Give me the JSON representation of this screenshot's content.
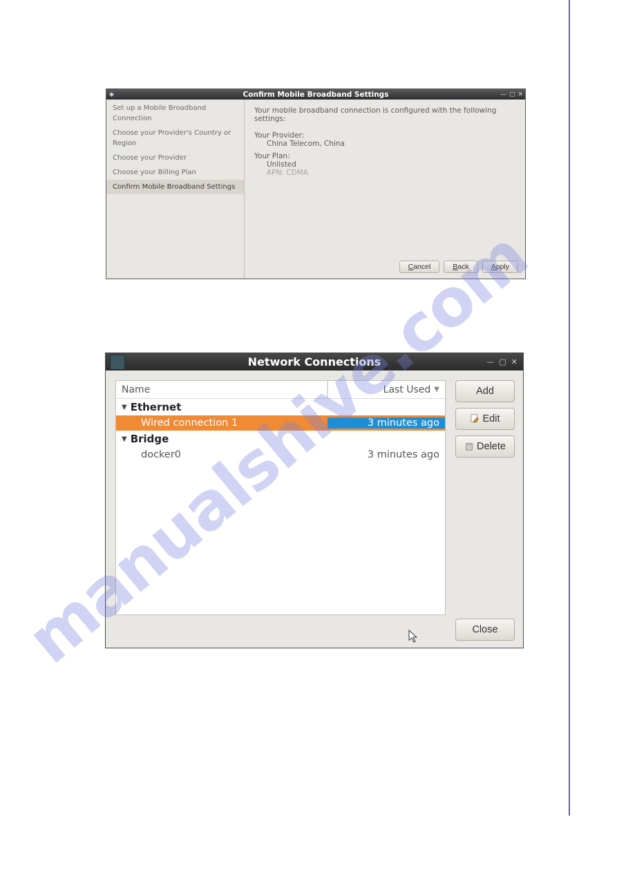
{
  "watermark": "manualshive.com",
  "window1": {
    "title": "Confirm Mobile Broadband Settings",
    "sidebar": [
      "Set up a Mobile Broadband Connection",
      "Choose your Provider's Country or Region",
      "Choose your Provider",
      "Choose your Billing Plan",
      "Confirm Mobile Broadband Settings"
    ],
    "selected_step_index": 4,
    "intro": "Your mobile broadband connection is configured with the following settings:",
    "provider_label": "Your Provider:",
    "provider_value": "China Telecom, China",
    "plan_label": "Your Plan:",
    "plan_value": "Unlisted",
    "plan_detail": "APN: CDMA",
    "buttons": {
      "cancel": "Cancel",
      "back": "Back",
      "apply": "Apply"
    }
  },
  "window2": {
    "title": "Network Connections",
    "columns": {
      "name": "Name",
      "last": "Last Used"
    },
    "group1": {
      "name": "Ethernet",
      "row": {
        "name": "Wired connection 1",
        "time": "3 minutes ago"
      }
    },
    "group2": {
      "name": "Bridge",
      "row": {
        "name": "docker0",
        "time": "3 minutes ago"
      }
    },
    "buttons": {
      "add": "Add",
      "edit": "Edit",
      "delete": "Delete",
      "close": "Close"
    }
  }
}
